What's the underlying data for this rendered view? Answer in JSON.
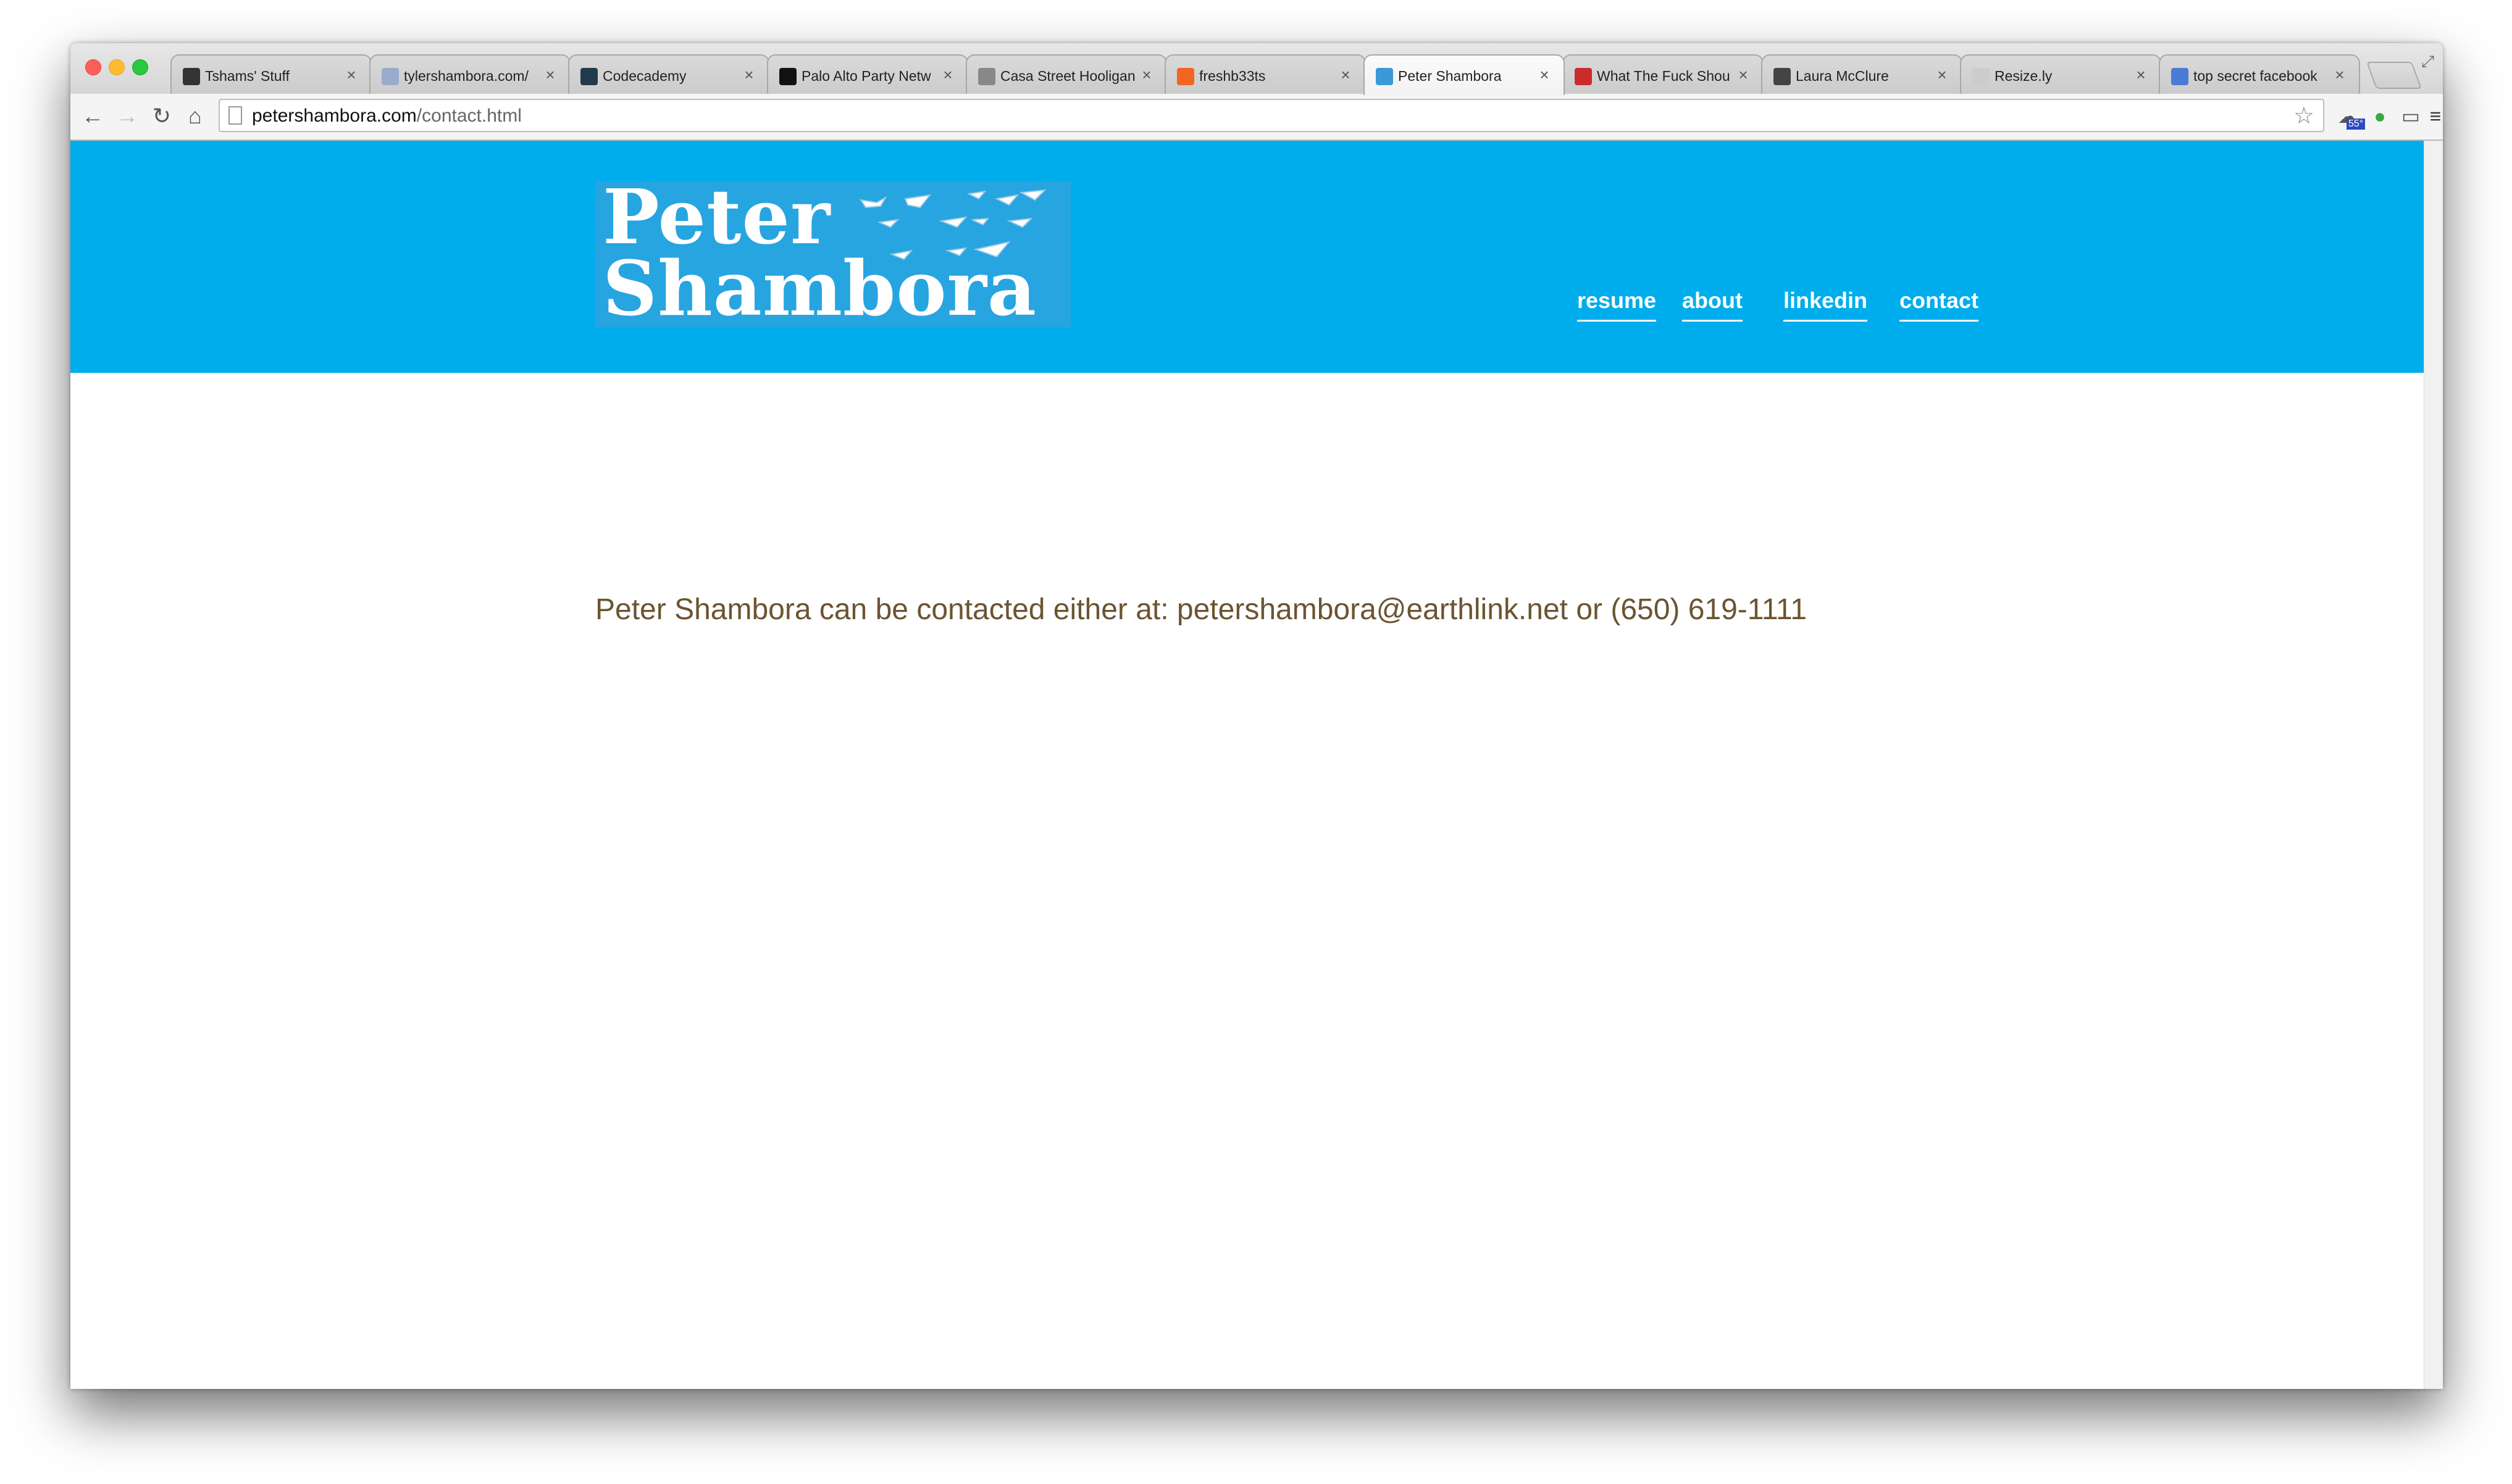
{
  "browser": {
    "tabs": [
      {
        "title": "Tshams' Stuff",
        "favicon_color": "#333333"
      },
      {
        "title": "tylershambora.com/",
        "favicon_color": "#9aaccc"
      },
      {
        "title": "Codecademy",
        "favicon_color": "#1f3b4d"
      },
      {
        "title": "Palo Alto Party Netw",
        "favicon_color": "#111111"
      },
      {
        "title": "Casa Street Hooligan",
        "favicon_color": "#888888"
      },
      {
        "title": "freshb33ts",
        "favicon_color": "#f26522"
      },
      {
        "title": "Peter Shambora",
        "favicon_color": "#3a9ad9"
      },
      {
        "title": "What The Fuck Shou",
        "favicon_color": "#cc2b2b"
      },
      {
        "title": "Laura McClure",
        "favicon_color": "#444444"
      },
      {
        "title": "Resize.ly",
        "favicon_color": "#cccccc"
      },
      {
        "title": "top secret facebook",
        "favicon_color": "#4a7bd6"
      }
    ],
    "active_tab_index": 6,
    "tab_close_glyph": "×",
    "address_bar": {
      "host": "petershambora.com",
      "path": "/contact.html"
    },
    "weather_badge": "55°"
  },
  "site": {
    "logo": {
      "line1": "Peter",
      "line2": "Shambora"
    },
    "nav": [
      "resume",
      "about",
      "linkedin",
      "contact"
    ],
    "contact_text": "Peter Shambora can be contacted either at: petershambora@earthlink.net or (650) 619-1111",
    "colors": {
      "header_bg": "#00adec",
      "text": "#6b5431"
    }
  }
}
